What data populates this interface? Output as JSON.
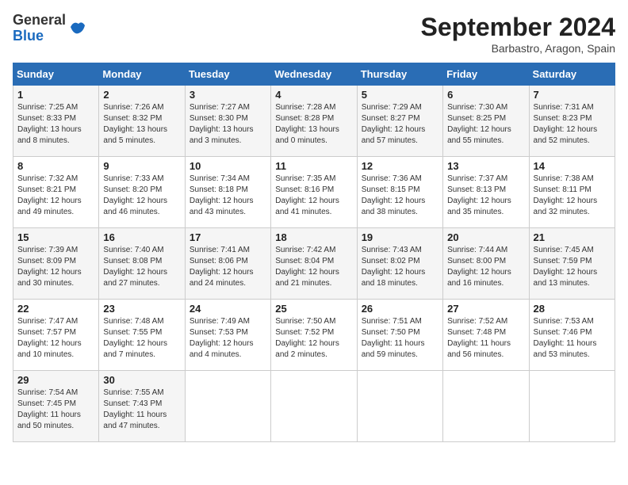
{
  "header": {
    "logo_line1": "General",
    "logo_line2": "Blue",
    "month_title": "September 2024",
    "location": "Barbastro, Aragon, Spain"
  },
  "weekdays": [
    "Sunday",
    "Monday",
    "Tuesday",
    "Wednesday",
    "Thursday",
    "Friday",
    "Saturday"
  ],
  "weeks": [
    [
      {
        "day": "1",
        "sunrise": "7:25 AM",
        "sunset": "8:33 PM",
        "daylight": "13 hours and 8 minutes."
      },
      {
        "day": "2",
        "sunrise": "7:26 AM",
        "sunset": "8:32 PM",
        "daylight": "13 hours and 5 minutes."
      },
      {
        "day": "3",
        "sunrise": "7:27 AM",
        "sunset": "8:30 PM",
        "daylight": "13 hours and 3 minutes."
      },
      {
        "day": "4",
        "sunrise": "7:28 AM",
        "sunset": "8:28 PM",
        "daylight": "13 hours and 0 minutes."
      },
      {
        "day": "5",
        "sunrise": "7:29 AM",
        "sunset": "8:27 PM",
        "daylight": "12 hours and 57 minutes."
      },
      {
        "day": "6",
        "sunrise": "7:30 AM",
        "sunset": "8:25 PM",
        "daylight": "12 hours and 55 minutes."
      },
      {
        "day": "7",
        "sunrise": "7:31 AM",
        "sunset": "8:23 PM",
        "daylight": "12 hours and 52 minutes."
      }
    ],
    [
      {
        "day": "8",
        "sunrise": "7:32 AM",
        "sunset": "8:21 PM",
        "daylight": "12 hours and 49 minutes."
      },
      {
        "day": "9",
        "sunrise": "7:33 AM",
        "sunset": "8:20 PM",
        "daylight": "12 hours and 46 minutes."
      },
      {
        "day": "10",
        "sunrise": "7:34 AM",
        "sunset": "8:18 PM",
        "daylight": "12 hours and 43 minutes."
      },
      {
        "day": "11",
        "sunrise": "7:35 AM",
        "sunset": "8:16 PM",
        "daylight": "12 hours and 41 minutes."
      },
      {
        "day": "12",
        "sunrise": "7:36 AM",
        "sunset": "8:15 PM",
        "daylight": "12 hours and 38 minutes."
      },
      {
        "day": "13",
        "sunrise": "7:37 AM",
        "sunset": "8:13 PM",
        "daylight": "12 hours and 35 minutes."
      },
      {
        "day": "14",
        "sunrise": "7:38 AM",
        "sunset": "8:11 PM",
        "daylight": "12 hours and 32 minutes."
      }
    ],
    [
      {
        "day": "15",
        "sunrise": "7:39 AM",
        "sunset": "8:09 PM",
        "daylight": "12 hours and 30 minutes."
      },
      {
        "day": "16",
        "sunrise": "7:40 AM",
        "sunset": "8:08 PM",
        "daylight": "12 hours and 27 minutes."
      },
      {
        "day": "17",
        "sunrise": "7:41 AM",
        "sunset": "8:06 PM",
        "daylight": "12 hours and 24 minutes."
      },
      {
        "day": "18",
        "sunrise": "7:42 AM",
        "sunset": "8:04 PM",
        "daylight": "12 hours and 21 minutes."
      },
      {
        "day": "19",
        "sunrise": "7:43 AM",
        "sunset": "8:02 PM",
        "daylight": "12 hours and 18 minutes."
      },
      {
        "day": "20",
        "sunrise": "7:44 AM",
        "sunset": "8:00 PM",
        "daylight": "12 hours and 16 minutes."
      },
      {
        "day": "21",
        "sunrise": "7:45 AM",
        "sunset": "7:59 PM",
        "daylight": "12 hours and 13 minutes."
      }
    ],
    [
      {
        "day": "22",
        "sunrise": "7:47 AM",
        "sunset": "7:57 PM",
        "daylight": "12 hours and 10 minutes."
      },
      {
        "day": "23",
        "sunrise": "7:48 AM",
        "sunset": "7:55 PM",
        "daylight": "12 hours and 7 minutes."
      },
      {
        "day": "24",
        "sunrise": "7:49 AM",
        "sunset": "7:53 PM",
        "daylight": "12 hours and 4 minutes."
      },
      {
        "day": "25",
        "sunrise": "7:50 AM",
        "sunset": "7:52 PM",
        "daylight": "12 hours and 2 minutes."
      },
      {
        "day": "26",
        "sunrise": "7:51 AM",
        "sunset": "7:50 PM",
        "daylight": "11 hours and 59 minutes."
      },
      {
        "day": "27",
        "sunrise": "7:52 AM",
        "sunset": "7:48 PM",
        "daylight": "11 hours and 56 minutes."
      },
      {
        "day": "28",
        "sunrise": "7:53 AM",
        "sunset": "7:46 PM",
        "daylight": "11 hours and 53 minutes."
      }
    ],
    [
      {
        "day": "29",
        "sunrise": "7:54 AM",
        "sunset": "7:45 PM",
        "daylight": "11 hours and 50 minutes."
      },
      {
        "day": "30",
        "sunrise": "7:55 AM",
        "sunset": "7:43 PM",
        "daylight": "11 hours and 47 minutes."
      },
      null,
      null,
      null,
      null,
      null
    ]
  ]
}
